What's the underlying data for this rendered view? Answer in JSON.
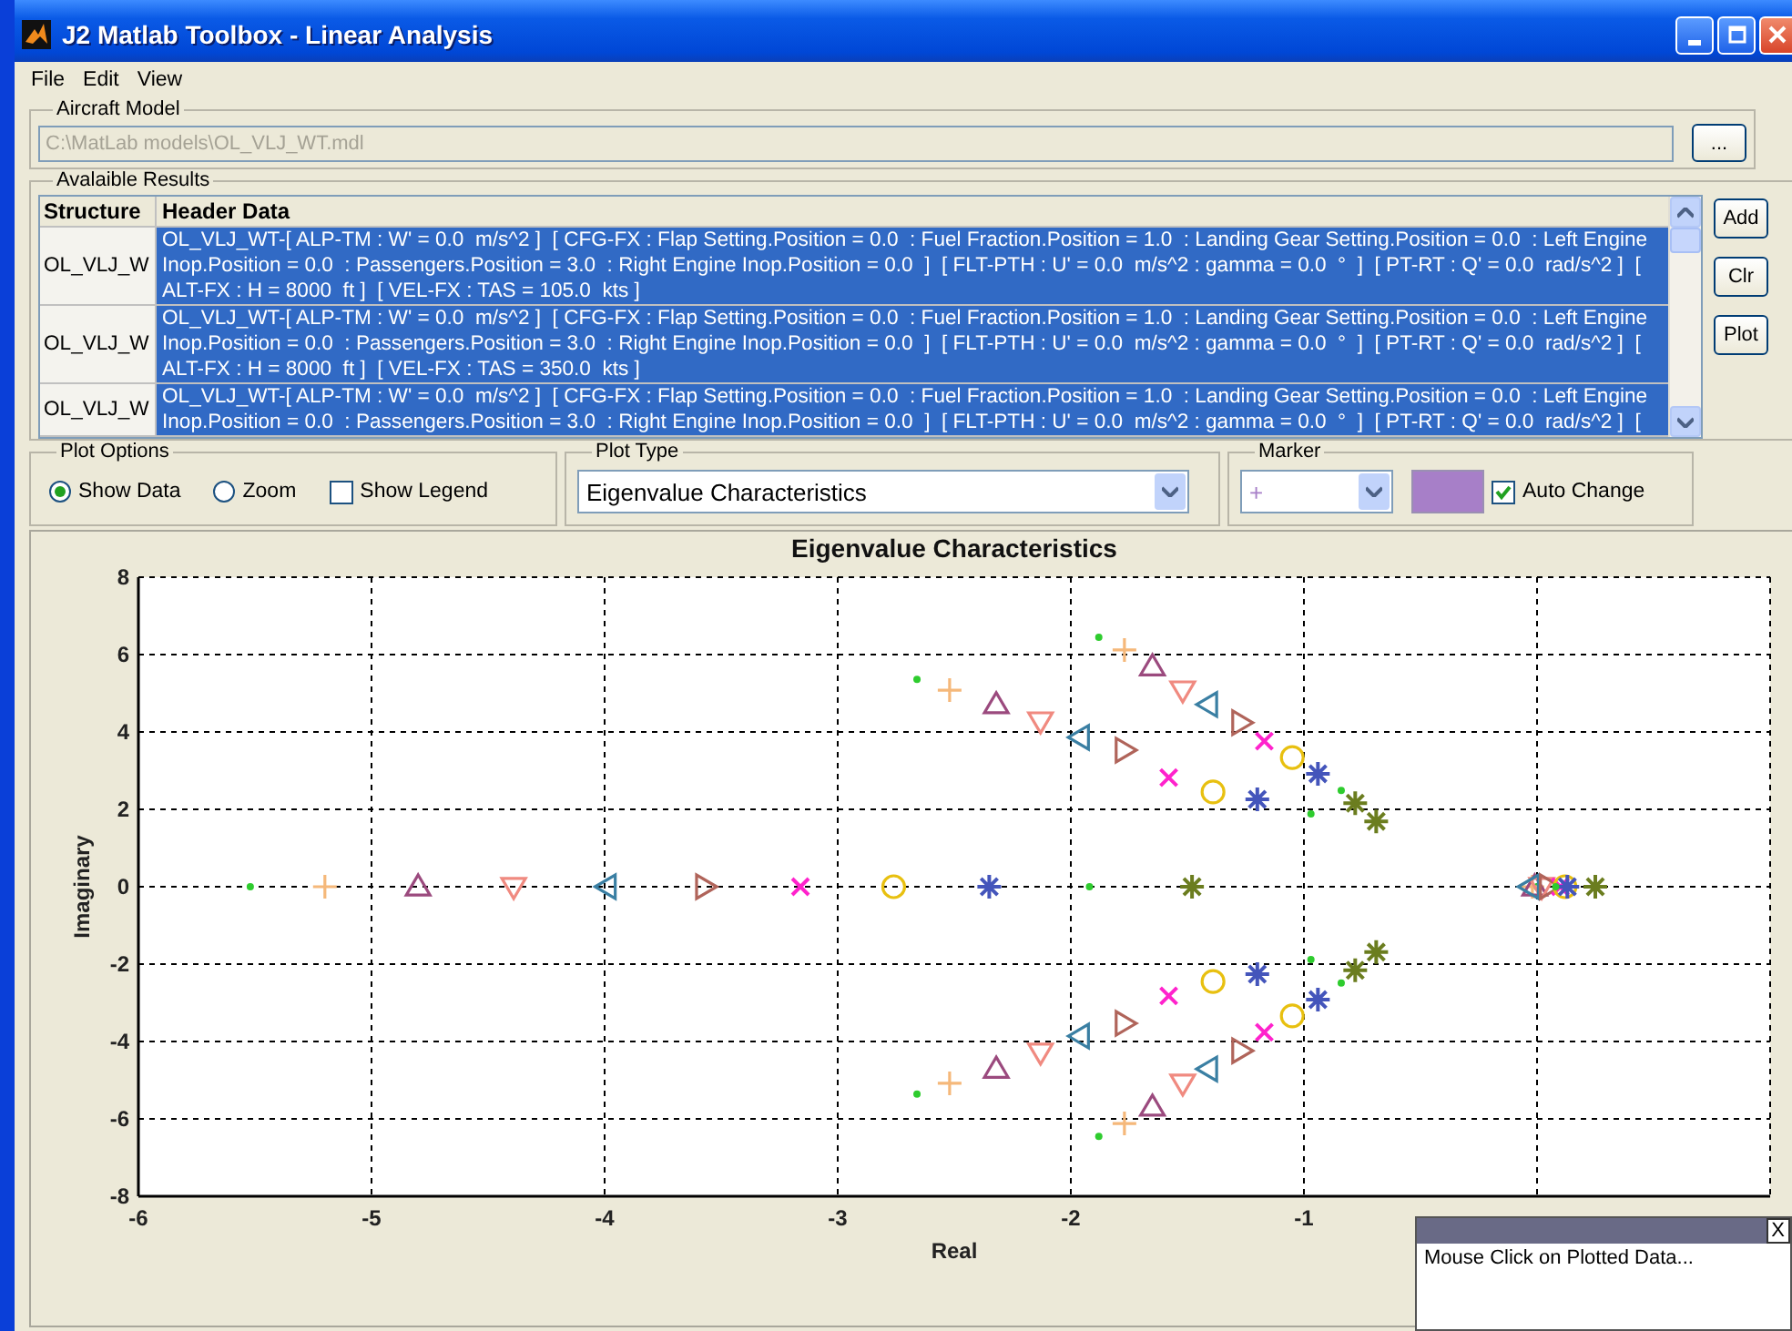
{
  "window": {
    "title": "J2 Matlab Toolbox - Linear Analysis"
  },
  "menu": [
    "File",
    "Edit",
    "View"
  ],
  "aircraft_model": {
    "label": "Aircraft Model",
    "value": "C:\\MatLab models\\OL_VLJ_WT.mdl",
    "disabled": true,
    "browse_button": "..."
  },
  "results": {
    "label": "Avalaible Results",
    "columns": [
      "Structure",
      "Header Data"
    ],
    "rows": [
      {
        "structure": "OL_VLJ_W",
        "header_data": "OL_VLJ_WT-[ ALP-TM : W' = 0.0  m/s^2 ]  [ CFG-FX : Flap Setting.Position = 0.0  : Fuel Fraction.Position = 1.0  : Landing Gear Setting.Position = 0.0  : Left Engine Inop.Position = 0.0  : Passengers.Position = 3.0  : Right Engine Inop.Position = 0.0  ]  [ FLT-PTH : U' = 0.0  m/s^2 : gamma = 0.0  °  ]  [ PT-RT : Q' = 0.0  rad/s^2 ]  [ ALT-FX : H = 8000  ft ]  [ VEL-FX : TAS = 105.0  kts ]",
        "selected": true
      },
      {
        "structure": "OL_VLJ_W",
        "header_data": "OL_VLJ_WT-[ ALP-TM : W' = 0.0  m/s^2 ]  [ CFG-FX : Flap Setting.Position = 0.0  : Fuel Fraction.Position = 1.0  : Landing Gear Setting.Position = 0.0  : Left Engine Inop.Position = 0.0  : Passengers.Position = 3.0  : Right Engine Inop.Position = 0.0  ]  [ FLT-PTH : U' = 0.0  m/s^2 : gamma = 0.0  °  ]  [ PT-RT : Q' = 0.0  rad/s^2 ]  [ ALT-FX : H = 8000  ft ]  [ VEL-FX : TAS = 350.0  kts ]",
        "selected": true
      },
      {
        "structure": "OL_VLJ_W",
        "header_data": "OL_VLJ_WT-[ ALP-TM : W' = 0.0  m/s^2 ]  [ CFG-FX : Flap Setting.Position = 0.0  : Fuel Fraction.Position = 1.0  : Landing Gear Setting.Position = 0.0  : Left Engine Inop.Position = 0.0  : Passengers.Position = 3.0  : Right Engine Inop.Position = 0.0  ]  [ FLT-PTH : U' = 0.0  m/s^2 : gamma = 0.0  °  ]  [ PT-RT : Q' = 0.0  rad/s^2 ]  [",
        "selected": true
      }
    ],
    "buttons": [
      "Add",
      "Clr",
      "Plot"
    ]
  },
  "plot_options": {
    "label": "Plot Options",
    "choices": [
      {
        "kind": "radio",
        "label": "Show Data",
        "selected": true
      },
      {
        "kind": "radio",
        "label": "Zoom",
        "selected": false
      },
      {
        "kind": "checkbox",
        "label": "Show Legend",
        "checked": false
      }
    ]
  },
  "plot_type": {
    "label": "Plot Type",
    "value": "Eigenvalue Characteristics"
  },
  "marker": {
    "label": "Marker",
    "symbol": "+",
    "color": "#a77fc8",
    "auto_change": {
      "label": "Auto Change",
      "checked": true
    }
  },
  "plot": {
    "chart_data": {
      "type": "scatter",
      "grid": true,
      "title": "Eigenvalue Characteristics",
      "xlabel": "Real",
      "ylabel": "Imaginary",
      "xlim": [
        -6,
        1
      ],
      "ylim": [
        -8,
        8
      ],
      "xticks": [
        {
          "value": -6,
          "label": "-6"
        },
        {
          "value": -5,
          "label": "-5"
        },
        {
          "value": -4,
          "label": "-4"
        },
        {
          "value": -3,
          "label": "-3"
        },
        {
          "value": -2,
          "label": "-2"
        },
        {
          "value": -1,
          "label": "-1"
        }
      ],
      "yticks": [
        -8,
        -6,
        -4,
        -2,
        0,
        2,
        4,
        6,
        8
      ],
      "series": [
        {
          "marker": "dot",
          "color": "#2ecc2e",
          "x": [
            -5.52,
            -2.66,
            -2.66,
            -1.88,
            -1.88,
            0
          ],
          "values": [
            0,
            5.36,
            -5.36,
            6.45,
            -6.45,
            0
          ]
        },
        {
          "marker": "plus",
          "color": "#f5b87a",
          "x": [
            -5.2,
            -2.52,
            -2.52,
            -1.77,
            -1.77,
            -0.02
          ],
          "values": [
            0,
            5.08,
            -5.08,
            6.12,
            -6.12,
            0
          ]
        },
        {
          "marker": "triangle-up",
          "color": "#9b4a7e",
          "x": [
            -4.8,
            -2.32,
            -2.32,
            -1.65,
            -1.65,
            -0.01
          ],
          "values": [
            0,
            4.71,
            -4.71,
            5.69,
            -5.69,
            0
          ]
        },
        {
          "marker": "triangle-down",
          "color": "#f08a80",
          "x": [
            -4.39,
            -2.13,
            -2.13,
            -1.52,
            -1.52,
            0.02
          ],
          "values": [
            0,
            4.28,
            -4.28,
            5.08,
            -5.08,
            0
          ]
        },
        {
          "marker": "triangle-left",
          "color": "#3a7fa3",
          "x": [
            -3.99,
            -1.96,
            -1.96,
            -1.41,
            -1.41,
            -0.03
          ],
          "values": [
            0,
            3.86,
            -3.86,
            4.71,
            -4.71,
            0
          ]
        },
        {
          "marker": "triangle-right",
          "color": "#b0645a",
          "x": [
            -3.57,
            -1.77,
            -1.77,
            -1.27,
            -1.27,
            0.05
          ],
          "values": [
            0,
            3.53,
            -3.53,
            4.24,
            -4.24,
            0
          ]
        },
        {
          "marker": "x",
          "color": "#ff22cc",
          "x": [
            -3.16,
            -1.58,
            -1.58,
            -1.17,
            -1.17,
            0.1
          ],
          "values": [
            0,
            2.82,
            -2.82,
            3.76,
            -3.76,
            0
          ]
        },
        {
          "marker": "circle",
          "color": "#e8c010",
          "x": [
            -2.76,
            -1.39,
            -1.39,
            -1.05,
            -1.05,
            0.12
          ],
          "values": [
            0,
            2.45,
            -2.45,
            3.34,
            -3.34,
            0
          ]
        },
        {
          "marker": "cross",
          "color": "#4455bb",
          "x": [
            -2.35,
            -1.2,
            -1.2,
            -0.94,
            -0.94,
            0.13
          ],
          "values": [
            0,
            2.26,
            -2.26,
            2.92,
            -2.92,
            0
          ]
        },
        {
          "marker": "dot",
          "color": "#2ecc2e",
          "x": [
            -1.92,
            -0.97,
            -0.97,
            -0.84,
            -0.84,
            0.08
          ],
          "values": [
            0,
            1.88,
            -1.88,
            2.49,
            -2.49,
            0
          ]
        },
        {
          "marker": "cross",
          "color": "#6b7d1f",
          "x": [
            -1.48,
            -0.78,
            -0.78,
            -0.69,
            -0.69,
            0.25
          ],
          "values": [
            0,
            2.16,
            -2.16,
            1.69,
            -1.69,
            0
          ]
        }
      ]
    }
  },
  "popup": {
    "close_label": "X",
    "message": "Mouse Click on Plotted Data..."
  }
}
